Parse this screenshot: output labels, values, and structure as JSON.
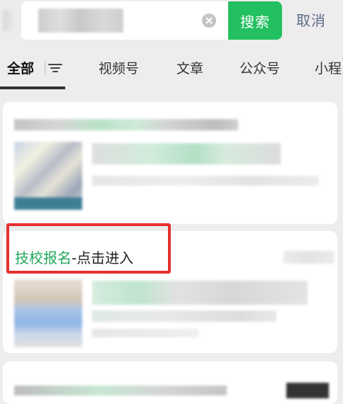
{
  "search": {
    "button_label": "搜索",
    "cancel_label": "取消"
  },
  "tabs": [
    {
      "label": "全部",
      "active": true
    },
    {
      "label": "视频号",
      "active": false
    },
    {
      "label": "文章",
      "active": false
    },
    {
      "label": "公众号",
      "active": false
    },
    {
      "label": "小程",
      "active": false
    }
  ],
  "results": {
    "second_title_highlight": "技校报名",
    "second_title_rest": "-点击进入"
  },
  "colors": {
    "accent_green": "#22c060",
    "highlight_text": "#22a85a",
    "annotation_red": "#e5302f"
  }
}
